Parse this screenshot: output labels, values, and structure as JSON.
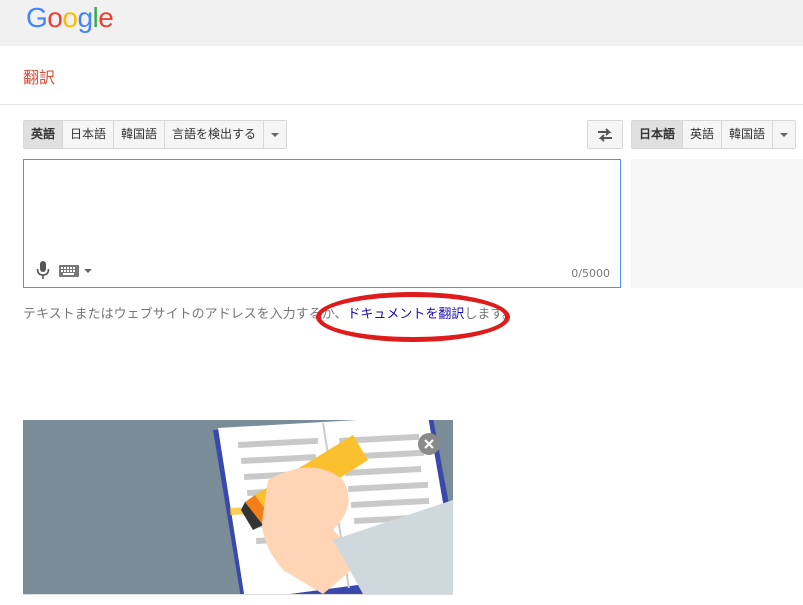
{
  "header": {
    "logo_letters": [
      {
        "char": "G",
        "color": "#4285F4"
      },
      {
        "char": "o",
        "color": "#EA4335"
      },
      {
        "char": "o",
        "color": "#FBBC05"
      },
      {
        "char": "g",
        "color": "#4285F4"
      },
      {
        "char": "l",
        "color": "#34A853"
      },
      {
        "char": "e",
        "color": "#EA4335"
      }
    ],
    "page_title": "翻訳"
  },
  "source_langs": {
    "items": [
      {
        "label": "英語",
        "selected": true
      },
      {
        "label": "日本語",
        "selected": false
      },
      {
        "label": "韓国語",
        "selected": false
      },
      {
        "label": "言語を検出する",
        "selected": false
      }
    ]
  },
  "target_langs": {
    "items": [
      {
        "label": "日本語",
        "selected": true
      },
      {
        "label": "英語",
        "selected": false
      },
      {
        "label": "韓国語",
        "selected": false
      }
    ]
  },
  "source_input": {
    "value": "",
    "char_count": "0/5000"
  },
  "hint": {
    "text": "テキストまたはウェブサイトのアドレスを入力するか、",
    "link": "ドキュメントを翻訳",
    "suffix": "します。"
  },
  "colors": {
    "accent_red": "#dd4b39",
    "annotation_red": "#e01b1b",
    "focus_blue": "#4d90fe"
  }
}
